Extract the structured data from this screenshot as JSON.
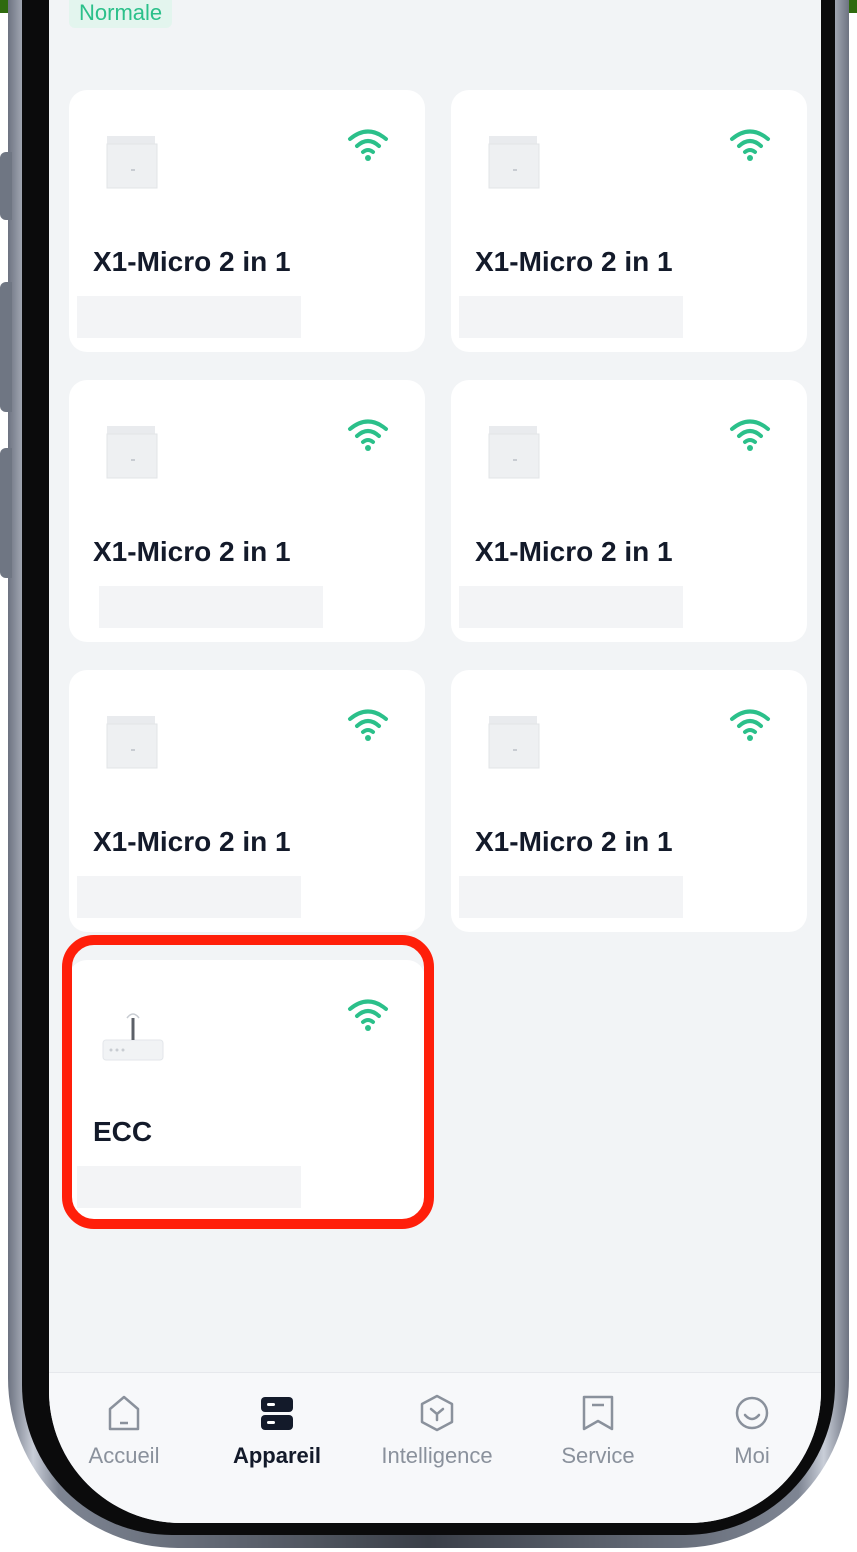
{
  "status_badge": "Normale",
  "devices": [
    {
      "name": "X1-Micro 2 in 1",
      "type": "inverter",
      "signal_icon": "wifi-icon"
    },
    {
      "name": "X1-Micro 2 in 1",
      "type": "inverter",
      "signal_icon": "wifi-icon"
    },
    {
      "name": "X1-Micro 2 in 1",
      "type": "inverter",
      "signal_icon": "wifi-icon"
    },
    {
      "name": "X1-Micro 2 in 1",
      "type": "inverter",
      "signal_icon": "wifi-icon"
    },
    {
      "name": "X1-Micro 2 in 1",
      "type": "inverter",
      "signal_icon": "wifi-icon"
    },
    {
      "name": "X1-Micro 2 in 1",
      "type": "inverter",
      "signal_icon": "wifi-icon"
    },
    {
      "name": "ECC",
      "type": "router",
      "signal_icon": "wifi-icon",
      "highlighted": true
    }
  ],
  "tabbar": {
    "items": [
      {
        "label": "Accueil",
        "icon": "home-icon",
        "active": false
      },
      {
        "label": "Appareil",
        "icon": "device-icon",
        "active": true
      },
      {
        "label": "Intelligence",
        "icon": "intelligence-icon",
        "active": false
      },
      {
        "label": "Service",
        "icon": "service-icon",
        "active": false
      },
      {
        "label": "Moi",
        "icon": "profile-icon",
        "active": false
      }
    ]
  },
  "colors": {
    "accent_green": "#2bc08a",
    "highlight_red": "#ff1f0a",
    "top_bar": "#2f6a0e",
    "text_dark": "#131a2a",
    "text_muted": "#8a919c"
  }
}
